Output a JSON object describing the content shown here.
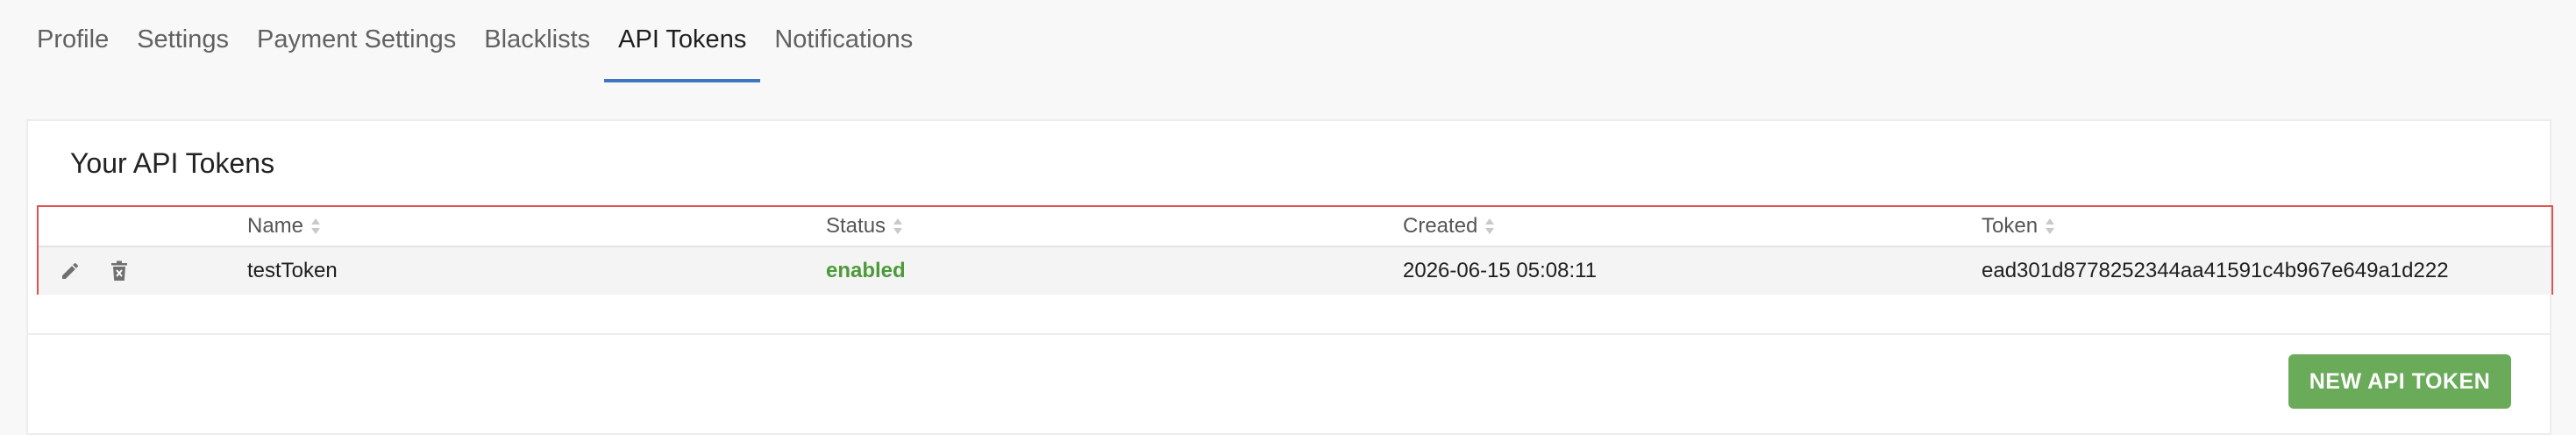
{
  "tabs": [
    {
      "label": "Profile"
    },
    {
      "label": "Settings"
    },
    {
      "label": "Payment Settings"
    },
    {
      "label": "Blacklists"
    },
    {
      "label": "API Tokens"
    },
    {
      "label": "Notifications"
    }
  ],
  "active_tab": "API Tokens",
  "card": {
    "title": "Your API Tokens"
  },
  "table": {
    "columns": [
      "Name",
      "Status",
      "Created",
      "Token"
    ],
    "rows": [
      {
        "name": "testToken",
        "status": "enabled",
        "created": "2026-06-15 05:08:11",
        "token": "ead301d8778252344aa41591c4b967e649a1d222",
        "actions": [
          "edit-icon",
          "delete-icon"
        ]
      }
    ]
  },
  "buttons": {
    "new_token": "NEW API TOKEN"
  },
  "colors": {
    "accent": "#3d77c2",
    "status_enabled": "#4c9a3a",
    "primary_button": "#6aab5a",
    "highlight_border": "#e05252"
  }
}
